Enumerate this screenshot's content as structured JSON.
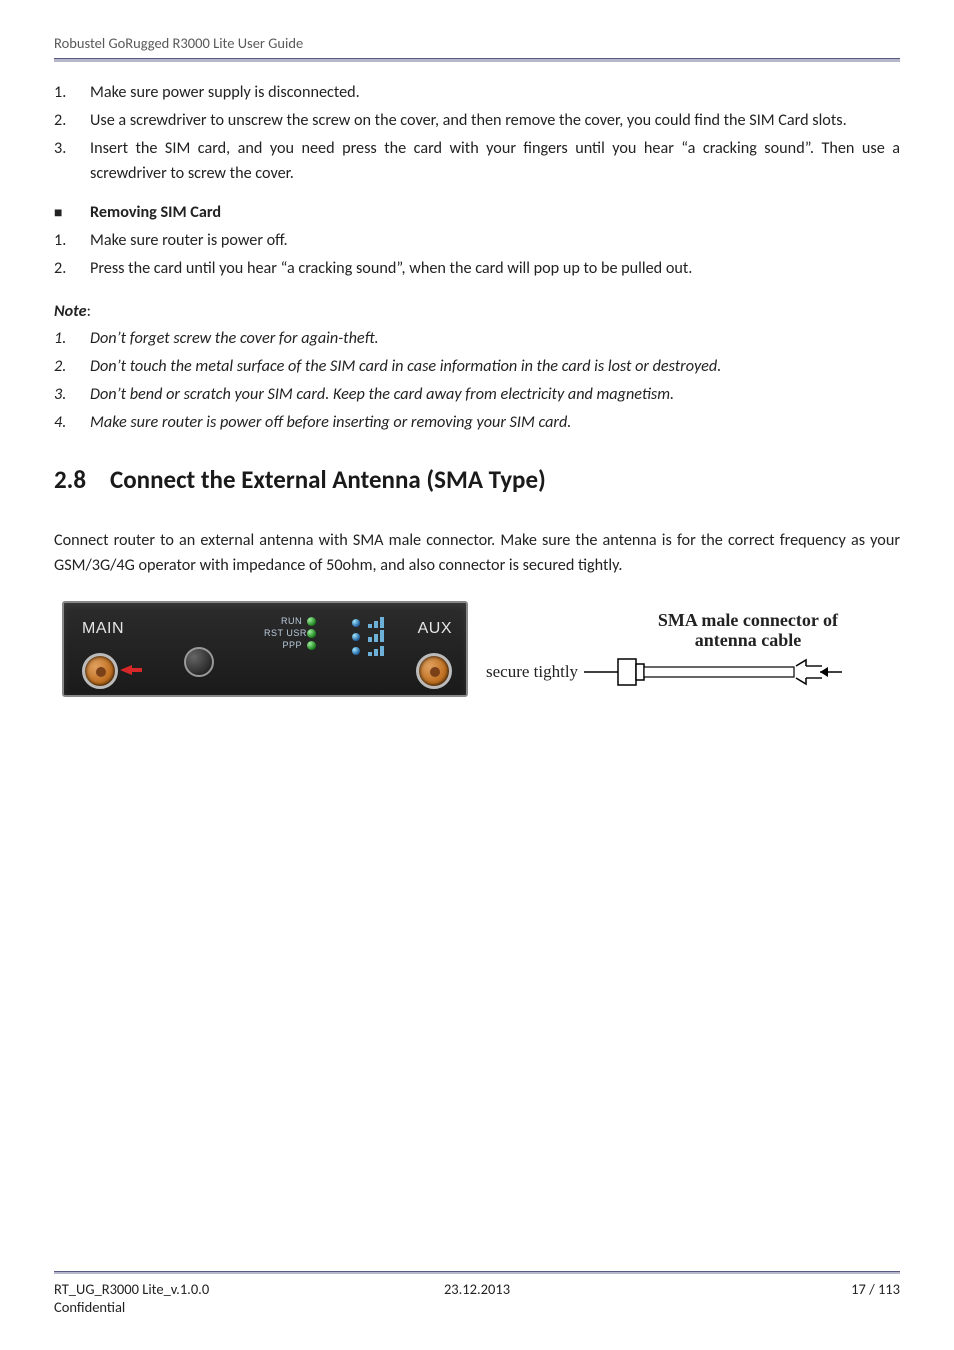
{
  "header": {
    "title": "Robustel GoRugged R3000 Lite User Guide"
  },
  "install_steps": [
    {
      "n": "1.",
      "t": "Make sure power supply is disconnected."
    },
    {
      "n": "2.",
      "t": "Use a screwdriver to unscrew the screw on the cover, and then remove the cover, you could find the SIM Card slots."
    },
    {
      "n": "3.",
      "t": "Insert the SIM card, and you need press the card with your fingers until you hear “a cracking sound”. Then use a screwdriver to screw the cover."
    }
  ],
  "remove_heading": "Removing SIM Card",
  "remove_steps": [
    {
      "n": "1.",
      "t": "Make sure router is power off."
    },
    {
      "n": "2.",
      "t": "Press the card until you hear “a cracking sound”, when the card will pop up to be pulled out."
    }
  ],
  "note_label_italic": "Note",
  "note_label_colon": ":",
  "notes": [
    {
      "n": "1.",
      "t": "Don’t forget screw the cover for again-theft."
    },
    {
      "n": "2.",
      "t": "Don’t touch the metal surface of the SIM card in case information in the card is lost or destroyed."
    },
    {
      "n": "3.",
      "t": "Don’t bend or scratch your SIM card. Keep the card away from electricity and magnetism."
    },
    {
      "n": "4.",
      "t": "Make sure router is power off before inserting or removing your SIM card."
    }
  ],
  "section": {
    "num": "2.8",
    "title": "Connect the External Antenna (SMA Type)"
  },
  "section_para": "Connect router to an external antenna with SMA male connector. Make sure the antenna is for the correct frequency as your GSM/3G/4G operator with impedance of 50ohm, and also connector is secured tightly.",
  "figure": {
    "main": "MAIN",
    "aux": "AUX",
    "leds": {
      "run": "RUN",
      "usr": "RST  USR",
      "ppp": "PPP"
    },
    "secure": "secure tightly",
    "conn_title_l1": "SMA male connector of",
    "conn_title_l2": "antenna cable"
  },
  "footer": {
    "doc": "RT_UG_R3000 Lite_v.1.0.0",
    "date": "23.12.2013",
    "page": "17 / 113",
    "conf": "Confidential"
  }
}
